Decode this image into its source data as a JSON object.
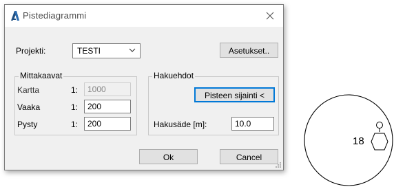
{
  "dialog": {
    "title": "Pistediagrammi",
    "app_icon": "autocad-a-icon",
    "close_icon": "close-icon"
  },
  "project": {
    "label": "Projekti:",
    "selected": "TESTI",
    "settings_button": "Asetukset.."
  },
  "scales": {
    "title": "Mittakaavat",
    "rows": [
      {
        "label": "Kartta",
        "prefix": "1:",
        "value": "1000",
        "enabled": false
      },
      {
        "label": "Vaaka",
        "prefix": "1:",
        "value": "200",
        "enabled": true
      },
      {
        "label": "Pysty",
        "prefix": "1:",
        "value": "200",
        "enabled": true
      }
    ]
  },
  "search": {
    "title": "Hakuehdot",
    "point_button": "Pisteen sijainti <",
    "radius_label": "Hakusäde [m]:",
    "radius_value": "10.0"
  },
  "footer": {
    "ok": "Ok",
    "cancel": "Cancel"
  },
  "drawing": {
    "label": "18",
    "symbol": "hexagon-point-symbol"
  }
}
